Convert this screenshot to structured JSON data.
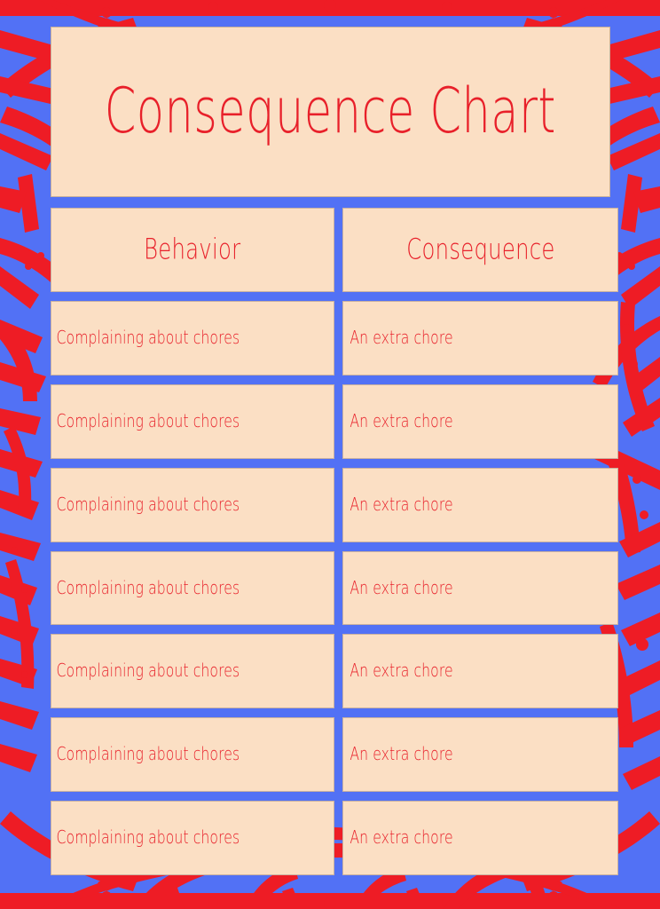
{
  "poster": {
    "title_line1": "Consequence",
    "title_line2": "Chart",
    "title_full": "Consequence Chart"
  },
  "colors": {
    "accent_red": "#e8202a",
    "accent_blue": "#5271f5",
    "card_background": "#fbdfc4",
    "card_border": "#c9b1a0"
  },
  "table": {
    "headers": {
      "behavior": "Behavior",
      "consequence": "Consequence"
    },
    "rows": [
      {
        "behavior": "Complaining about chores",
        "consequence": "An extra chore"
      },
      {
        "behavior": "Complaining about chores",
        "consequence": "An extra chore"
      },
      {
        "behavior": "Complaining about chores",
        "consequence": "An extra chore"
      },
      {
        "behavior": "Complaining about chores",
        "consequence": "An extra chore"
      },
      {
        "behavior": "Complaining about chores",
        "consequence": "An extra chore"
      },
      {
        "behavior": "Complaining about chores",
        "consequence": "An extra chore"
      },
      {
        "behavior": "Complaining about chores",
        "consequence": "An extra chore"
      }
    ]
  }
}
